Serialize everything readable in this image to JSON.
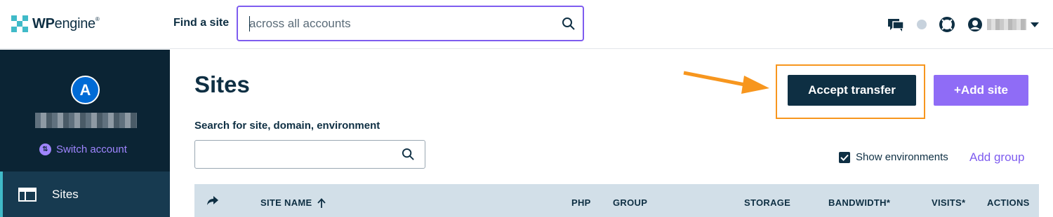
{
  "header": {
    "logo": {
      "bold": "WP",
      "light": "engine",
      "mark": "®"
    },
    "find_label": "Find a site",
    "find_placeholder": "across all accounts",
    "icons": [
      "chat-icon",
      "status-dot",
      "help-lifebuoy-icon",
      "user-icon",
      "chevron-down-icon"
    ]
  },
  "sidebar": {
    "avatar_letter": "A",
    "switch_label": "Switch account",
    "items": [
      {
        "label": "Sites",
        "icon": "sites-icon",
        "active": true
      }
    ]
  },
  "main": {
    "title": "Sites",
    "search_label": "Search for site, domain, environment",
    "search_value": "",
    "accept_transfer": "Accept transfer",
    "add_site": "+Add site",
    "show_environments": "Show environments",
    "show_environments_checked": true,
    "add_group": "Add group"
  },
  "table": {
    "columns": [
      "SITE NAME",
      "PHP",
      "GROUP",
      "STORAGE",
      "BANDWIDTH*",
      "VISITS*",
      "ACTIONS"
    ]
  },
  "colors": {
    "navy": "#0e2f43",
    "purple": "#7e5cef",
    "orange": "#f7961e",
    "teal": "#40bac8"
  }
}
